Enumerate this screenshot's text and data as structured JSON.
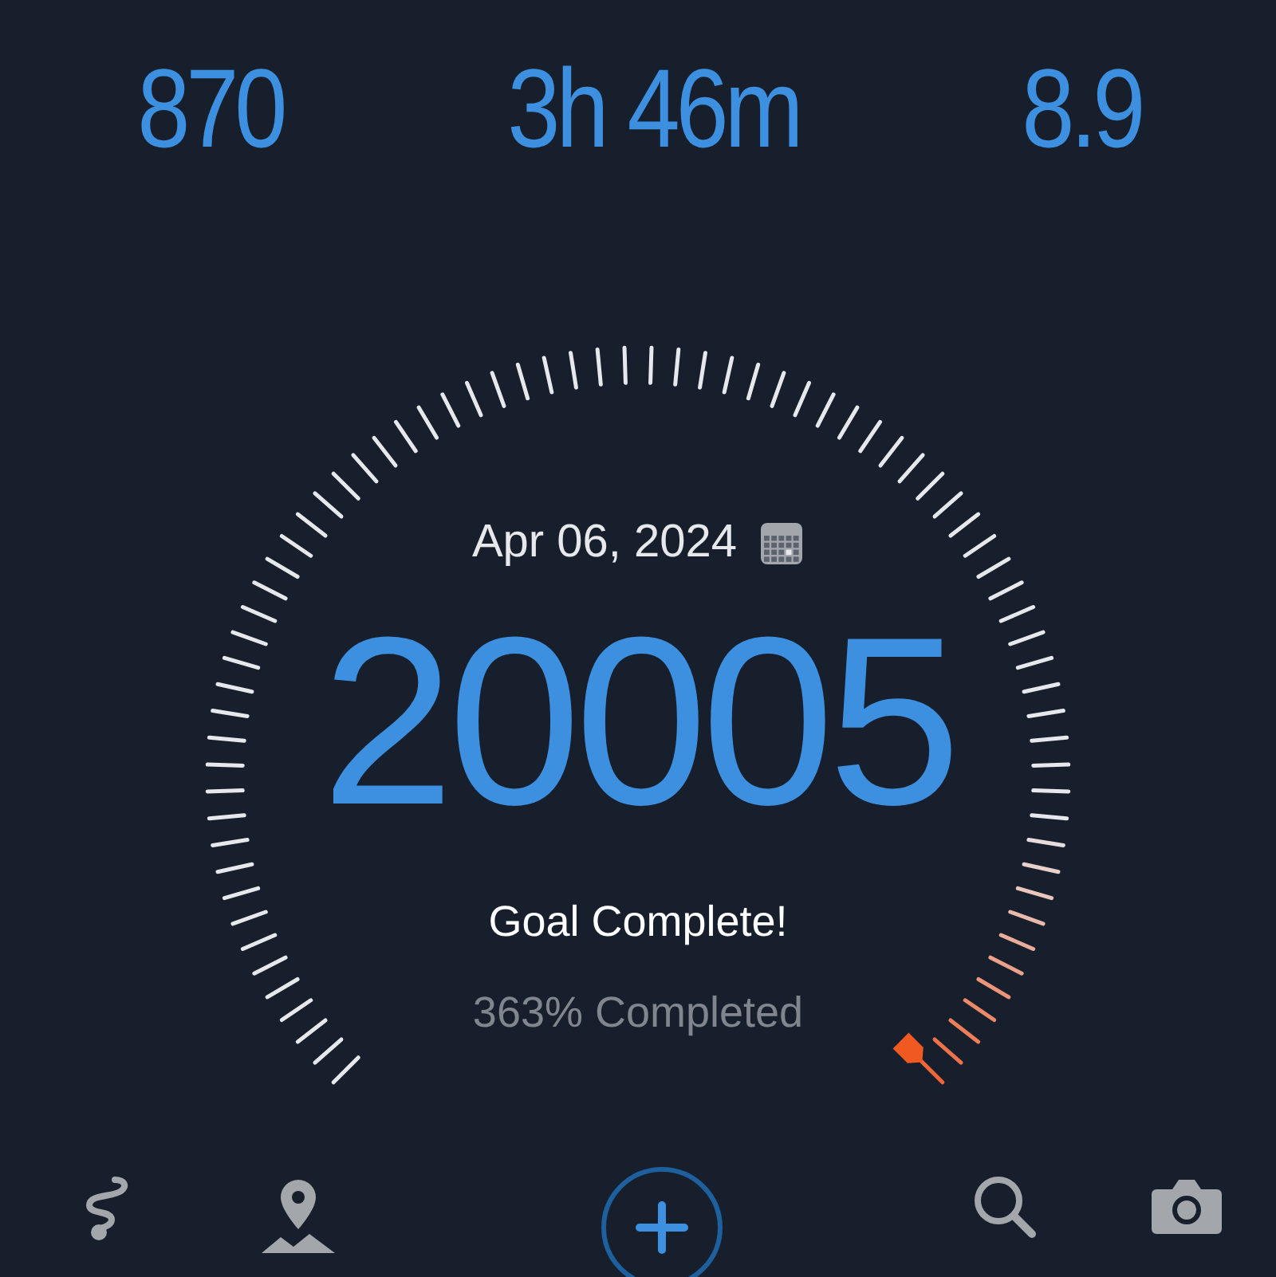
{
  "stats": [
    "870",
    "3h 46m",
    "8.9"
  ],
  "dial": {
    "date": "Apr 06, 2024",
    "steps": "20005",
    "status": "Goal Complete!",
    "progress": "363% Completed"
  },
  "nav": [
    {
      "kind": "route"
    },
    {
      "kind": "map"
    },
    {
      "kind": "add"
    },
    {
      "kind": "search"
    },
    {
      "kind": "camera"
    }
  ]
}
